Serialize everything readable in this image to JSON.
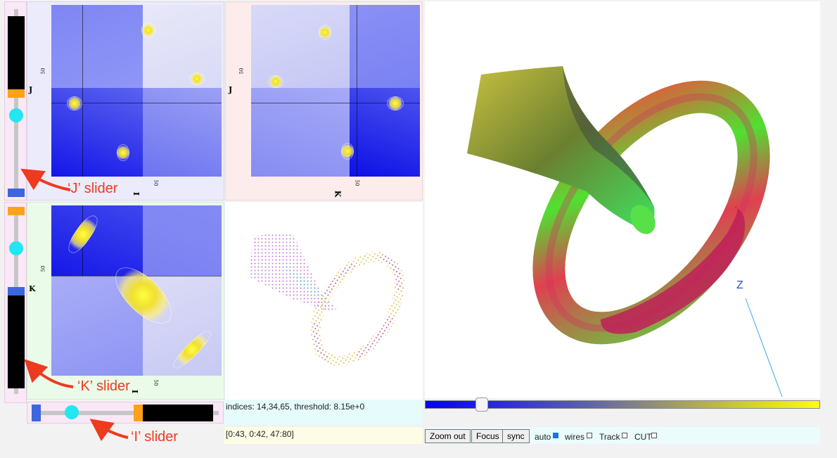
{
  "sliders": {
    "j": {
      "annotation": "‘J’ slider"
    },
    "k": {
      "annotation": "‘K’ slider"
    },
    "i": {
      "annotation": "‘I’ slider"
    }
  },
  "panels": {
    "ij": {
      "y_axis": "J",
      "x_axis": "I",
      "y_tick": "50",
      "x_tick": "50"
    },
    "kj": {
      "y_axis": "J",
      "x_axis": "K",
      "y_tick": "50",
      "x_tick": "50"
    },
    "ik": {
      "y_axis": "K",
      "x_axis": "I",
      "y_tick": "50",
      "x_tick": "50"
    }
  },
  "view3d": {
    "axis_label": "Z"
  },
  "status": {
    "indices_text": "indices: 14,34,65, threshold: 8.15e+0",
    "range_text": "[0:43, 0:42, 47:80]"
  },
  "threshold_slider": {
    "value_fraction": 0.14,
    "color_start": "#0000ff",
    "color_end": "#ffff00"
  },
  "controls": {
    "zoom_out": "Zoom out",
    "focus": "Focus",
    "sync": "sync",
    "auto": {
      "label": "auto",
      "checked": true
    },
    "wires": {
      "label": "wires",
      "checked": false
    },
    "track": {
      "label": "Track",
      "checked": false
    },
    "cut": {
      "label": "CUT",
      "checked": false
    }
  },
  "colors": {
    "accent_orange": "#ffa21a",
    "accent_blue": "#3b66dd",
    "knob": "#22e6f2",
    "annotation": "#ee3a1f"
  }
}
